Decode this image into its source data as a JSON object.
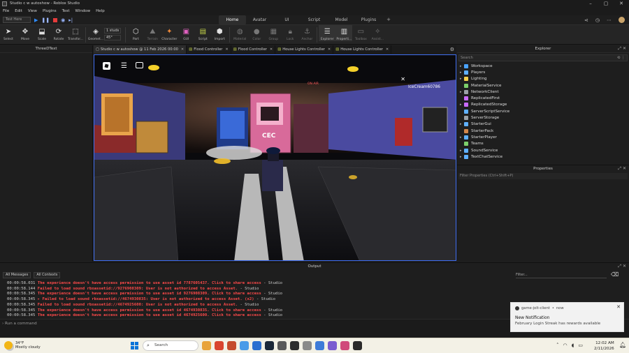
{
  "window": {
    "title": "Studio c w autoshow - Roblox Studio"
  },
  "menu": [
    "File",
    "Edit",
    "View",
    "Plugins",
    "Test",
    "Window",
    "Help"
  ],
  "ribbon_tabs": [
    {
      "label": "Home",
      "active": true
    },
    {
      "label": "Avatar",
      "active": false
    },
    {
      "label": "UI",
      "active": false
    },
    {
      "label": "Script",
      "active": false
    },
    {
      "label": "Model",
      "active": false
    },
    {
      "label": "Plugins",
      "active": false
    }
  ],
  "run": {
    "test_dropdown": "Test Here"
  },
  "toolbar": {
    "tools": [
      {
        "label": "Select",
        "icon": "cursor-icon"
      },
      {
        "label": "Move",
        "icon": "move-icon"
      },
      {
        "label": "Scale",
        "icon": "scale-icon"
      },
      {
        "label": "Rotate",
        "icon": "rotate-icon"
      },
      {
        "label": "Transfor...",
        "icon": "transform-icon"
      },
      {
        "label": "Geomet...",
        "icon": "geometry-icon"
      }
    ],
    "snap": {
      "move": "1 studs",
      "rotate": "45°"
    },
    "tools2": [
      {
        "label": "Part",
        "icon": "part-icon",
        "dim": false
      },
      {
        "label": "Terrain",
        "icon": "terrain-icon",
        "dim": true
      },
      {
        "label": "Character",
        "icon": "character-icon",
        "dim": false
      },
      {
        "label": "GUI",
        "icon": "gui-icon",
        "dim": false
      },
      {
        "label": "Script",
        "icon": "script-icon",
        "dim": false
      },
      {
        "label": "Import",
        "icon": "import-icon",
        "dim": false
      },
      {
        "label": "Material",
        "icon": "material-icon",
        "dim": true
      },
      {
        "label": "Color",
        "icon": "color-icon",
        "dim": true
      },
      {
        "label": "Group",
        "icon": "group-icon",
        "dim": true
      },
      {
        "label": "Lock",
        "icon": "lock-icon",
        "dim": true
      },
      {
        "label": "Anchor",
        "icon": "anchor-icon",
        "dim": true
      },
      {
        "label": "Explorer",
        "icon": "explorer-icon",
        "dim": false
      },
      {
        "label": "Properti...",
        "icon": "properties-icon",
        "dim": false
      },
      {
        "label": "Toolbox",
        "icon": "toolbox-icon",
        "dim": true
      },
      {
        "label": "Assist...",
        "icon": "assistant-icon",
        "dim": true
      }
    ]
  },
  "left_panel": {
    "title": "ThreeDText"
  },
  "editor_tabs": [
    {
      "label": "Studio c w autoshow @ 11 Feb 2026 00:00",
      "active": true
    },
    {
      "label": "Flood Controller",
      "active": false
    },
    {
      "label": "Flood Controller",
      "active": false
    },
    {
      "label": "House Lights Controller",
      "active": false
    },
    {
      "label": "House Lights Controller",
      "active": false
    }
  ],
  "viewport": {
    "player_name": "IceCream60786",
    "stage_sign": "CEC",
    "banner": "ON AIR"
  },
  "explorer": {
    "title": "Explorer",
    "search_placeholder": "Search",
    "items": [
      {
        "label": "Workspace",
        "color": "#4aa3ff",
        "expandable": true
      },
      {
        "label": "Players",
        "color": "#5fb0ff",
        "expandable": true
      },
      {
        "label": "Lighting",
        "color": "#f5d04a",
        "expandable": true
      },
      {
        "label": "MaterialService",
        "color": "#7ccf6a",
        "expandable": false
      },
      {
        "label": "NetworkClient",
        "color": "#9aa0a6",
        "expandable": true
      },
      {
        "label": "ReplicatedFirst",
        "color": "#c96bff",
        "expandable": false
      },
      {
        "label": "ReplicatedStorage",
        "color": "#c96bff",
        "expandable": true
      },
      {
        "label": "ServerScriptService",
        "color": "#5fb0ff",
        "expandable": false
      },
      {
        "label": "ServerStorage",
        "color": "#9aa0a6",
        "expandable": false
      },
      {
        "label": "StarterGui",
        "color": "#5fb0ff",
        "expandable": true
      },
      {
        "label": "StarterPack",
        "color": "#d2874a",
        "expandable": false
      },
      {
        "label": "StarterPlayer",
        "color": "#5fb0ff",
        "expandable": true
      },
      {
        "label": "Teams",
        "color": "#7ccf6a",
        "expandable": false
      },
      {
        "label": "SoundService",
        "color": "#5fb0ff",
        "expandable": true
      },
      {
        "label": "TextChatService",
        "color": "#5fb0ff",
        "expandable": true
      }
    ]
  },
  "properties": {
    "title": "Properties",
    "filter_placeholder": "Filter Properties (Ctrl+Shift+P)"
  },
  "output": {
    "title": "Output",
    "filter_messages": "All Messages",
    "filter_contexts": "All Contexts",
    "filter_placeholder": "Filter...",
    "logs": [
      {
        "ts": "00:00:58.031",
        "msg": "The experience doesn't have access permission to use asset id 7787605437. Click to share access",
        "src": "-  Studio"
      },
      {
        "ts": "00:00:58.144",
        "msg": "Failed to load sound rbxassetid://9276908309: User is not authorized to access Asset.",
        "src": "-  Studio"
      },
      {
        "ts": "00:00:58.345",
        "msg": "The experience doesn't have access permission to use asset id 9276908309. Click to share access",
        "src": "-  Studio"
      },
      {
        "ts": "00:00:58.345",
        "msg": " ▸ Failed to load sound rbxassetid://4674930835: User is not authorized to access Asset. (x2)",
        "src": "-  Studio"
      },
      {
        "ts": "00:00:58.345",
        "msg": "Failed to load sound rbxassetid://4674925600: User is not authorized to access Asset.",
        "src": "-  Studio"
      },
      {
        "ts": "00:00:58.345",
        "msg": "The experience doesn't have access permission to use asset id 4674930835. Click to share access",
        "src": "-  Studio"
      },
      {
        "ts": "00:00:58.345",
        "msg": "The experience doesn't have access permission to use asset id 4674925600. Click to share access",
        "src": "-  Studio"
      }
    ]
  },
  "command_bar": {
    "placeholder": "Run a command"
  },
  "notification": {
    "app": "game-jolt-client",
    "time": "now",
    "title": "New Notification",
    "body": "February Login Streak has rewards available"
  },
  "taskbar": {
    "weather_temp": "34°F",
    "weather_desc": "Mostly cloudy",
    "search_label": "Search",
    "time": "12:02 AM",
    "date": "2/11/2026",
    "app_colors": [
      "#e8a33a",
      "#d9442f",
      "#c54b2c",
      "#4a9be8",
      "#2b6fd0",
      "#1b2838",
      "#5a5a5a",
      "#2d2d2d",
      "#8a8a8a",
      "#3e7bd8",
      "#7a5cd0",
      "#d04a7a",
      "#2a2a2a"
    ]
  }
}
